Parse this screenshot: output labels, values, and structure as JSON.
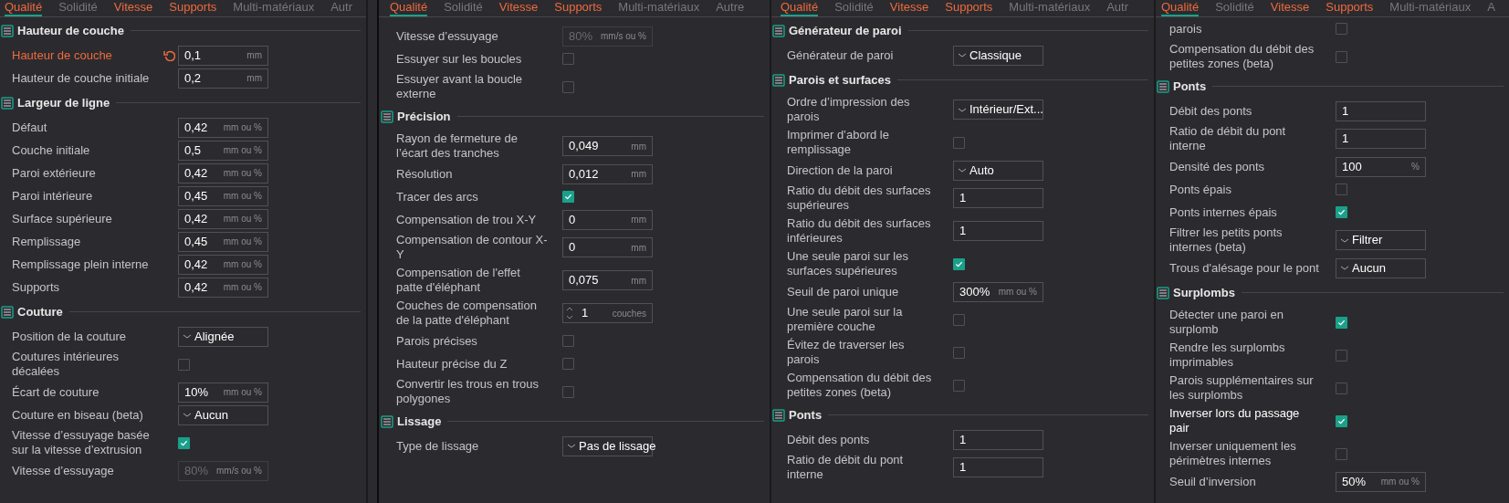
{
  "panels": [
    {
      "tabs": [
        {
          "label": "Qualité",
          "selected": true,
          "modified": true
        },
        {
          "label": "Solidité",
          "selected": false,
          "modified": false
        },
        {
          "label": "Vitesse",
          "selected": false,
          "modified": true
        },
        {
          "label": "Supports",
          "selected": false,
          "modified": true
        },
        {
          "label": "Multi-matériaux",
          "selected": false,
          "modified": false
        },
        {
          "label": "Autr",
          "selected": false,
          "modified": false
        }
      ],
      "items": [
        {
          "kind": "section",
          "title": "Hauteur de couche"
        },
        {
          "kind": "field",
          "label": "Hauteur de couche",
          "value": "0,1",
          "unit": "mm",
          "disabled": false,
          "modified": true,
          "hovered": false
        },
        {
          "kind": "field",
          "label": "Hauteur de couche initiale",
          "value": "0,2",
          "unit": "mm",
          "disabled": false,
          "modified": false,
          "hovered": false
        },
        {
          "kind": "section",
          "title": "Largeur de ligne"
        },
        {
          "kind": "field",
          "label": "Défaut",
          "value": "0,42",
          "unit": "mm ou %",
          "disabled": false,
          "modified": false,
          "hovered": false
        },
        {
          "kind": "field",
          "label": "Couche initiale",
          "value": "0,5",
          "unit": "mm ou %",
          "disabled": false,
          "modified": false,
          "hovered": false
        },
        {
          "kind": "field",
          "label": "Paroi extérieure",
          "value": "0,42",
          "unit": "mm ou %",
          "disabled": false,
          "modified": false,
          "hovered": false
        },
        {
          "kind": "field",
          "label": "Paroi intérieure",
          "value": "0,45",
          "unit": "mm ou %",
          "disabled": false,
          "modified": false,
          "hovered": false
        },
        {
          "kind": "field",
          "label": "Surface supérieure",
          "value": "0,42",
          "unit": "mm ou %",
          "disabled": false,
          "modified": false,
          "hovered": false
        },
        {
          "kind": "field",
          "label": "Remplissage",
          "value": "0,45",
          "unit": "mm ou %",
          "disabled": false,
          "modified": false,
          "hovered": false
        },
        {
          "kind": "field",
          "label": "Remplissage plein interne",
          "value": "0,42",
          "unit": "mm ou %",
          "disabled": false,
          "modified": false,
          "hovered": false
        },
        {
          "kind": "field",
          "label": "Supports",
          "value": "0,42",
          "unit": "mm ou %",
          "disabled": false,
          "modified": false,
          "hovered": false
        },
        {
          "kind": "section",
          "title": "Couture"
        },
        {
          "kind": "combo",
          "label": "Position de la couture",
          "value": "Alignée",
          "modified": false,
          "hovered": false
        },
        {
          "kind": "checkbox",
          "label": "Coutures intérieures décalées",
          "checked": false,
          "modified": false,
          "hovered": false
        },
        {
          "kind": "field",
          "label": "Écart de couture",
          "value": "10%",
          "unit": "mm ou %",
          "disabled": false,
          "modified": false,
          "hovered": false
        },
        {
          "kind": "combo",
          "label": "Couture en biseau (beta)",
          "value": "Aucun",
          "modified": false,
          "hovered": false
        },
        {
          "kind": "checkbox",
          "label": "Vitesse d’essuyage basée sur la vitesse d’extrusion",
          "checked": true,
          "modified": false,
          "hovered": false
        },
        {
          "kind": "field",
          "label": "Vitesse d’essuyage",
          "value": "80%",
          "unit": "mm/s ou %",
          "disabled": true,
          "modified": false,
          "hovered": false
        }
      ]
    },
    {
      "tabs": [
        {
          "label": "Qualité",
          "selected": true,
          "modified": true
        },
        {
          "label": "Solidité",
          "selected": false,
          "modified": false
        },
        {
          "label": "Vitesse",
          "selected": false,
          "modified": true
        },
        {
          "label": "Supports",
          "selected": false,
          "modified": true
        },
        {
          "label": "Multi-matériaux",
          "selected": false,
          "modified": false
        },
        {
          "label": "Autre",
          "selected": false,
          "modified": false
        }
      ],
      "items": [
        {
          "kind": "field",
          "label": "Vitesse d’essuyage",
          "value": "80%",
          "unit": "mm/s ou %",
          "disabled": true,
          "modified": false,
          "hovered": false
        },
        {
          "kind": "checkbox",
          "label": "Essuyer sur les boucles",
          "checked": false,
          "modified": false,
          "hovered": false
        },
        {
          "kind": "checkbox",
          "label": "Essuyer avant la boucle externe",
          "checked": false,
          "modified": false,
          "hovered": false
        },
        {
          "kind": "section",
          "title": "Précision"
        },
        {
          "kind": "field",
          "label": "Rayon de fermeture de l’écart des tranches",
          "value": "0,049",
          "unit": "mm",
          "disabled": false,
          "modified": false,
          "hovered": false
        },
        {
          "kind": "field",
          "label": "Résolution",
          "value": "0,012",
          "unit": "mm",
          "disabled": false,
          "modified": false,
          "hovered": false
        },
        {
          "kind": "checkbox",
          "label": "Tracer des arcs",
          "checked": true,
          "modified": false,
          "hovered": false
        },
        {
          "kind": "field",
          "label": "Compensation de trou X-Y",
          "value": "0",
          "unit": "mm",
          "disabled": false,
          "modified": false,
          "hovered": false
        },
        {
          "kind": "field",
          "label": "Compensation de contour X-Y",
          "value": "0",
          "unit": "mm",
          "disabled": false,
          "modified": false,
          "hovered": false
        },
        {
          "kind": "field",
          "label": "Compensation de l'effet patte d'éléphant",
          "value": "0,075",
          "unit": "mm",
          "disabled": false,
          "modified": false,
          "hovered": false
        },
        {
          "kind": "spin",
          "label": "Couches de compensation de la patte d'éléphant",
          "value": "1",
          "unit": "couches",
          "modified": false,
          "hovered": false
        },
        {
          "kind": "checkbox",
          "label": "Parois précises",
          "checked": false,
          "modified": false,
          "hovered": false
        },
        {
          "kind": "checkbox",
          "label": "Hauteur précise du Z",
          "checked": false,
          "modified": false,
          "hovered": false
        },
        {
          "kind": "checkbox",
          "label": "Convertir les trous en trous polygones",
          "checked": false,
          "modified": false,
          "hovered": false
        },
        {
          "kind": "section",
          "title": "Lissage"
        },
        {
          "kind": "combo",
          "label": "Type de lissage",
          "value": "Pas de lissage",
          "modified": false,
          "hovered": false
        }
      ]
    },
    {
      "tabs": [
        {
          "label": "Qualité",
          "selected": true,
          "modified": true
        },
        {
          "label": "Solidité",
          "selected": false,
          "modified": false
        },
        {
          "label": "Vitesse",
          "selected": false,
          "modified": true
        },
        {
          "label": "Supports",
          "selected": false,
          "modified": true
        },
        {
          "label": "Multi-matériaux",
          "selected": false,
          "modified": false
        },
        {
          "label": "Autr",
          "selected": false,
          "modified": false
        }
      ],
      "items": [
        {
          "kind": "section",
          "title": "Générateur de paroi"
        },
        {
          "kind": "combo",
          "label": "Générateur de paroi",
          "value": "Classique",
          "modified": false,
          "hovered": false
        },
        {
          "kind": "section",
          "title": "Parois et surfaces"
        },
        {
          "kind": "combo",
          "label": "Ordre d’impression des parois",
          "value": "Intérieur/Ext...",
          "modified": false,
          "hovered": false
        },
        {
          "kind": "checkbox",
          "label": "Imprimer d’abord le remplissage",
          "checked": false,
          "modified": false,
          "hovered": false
        },
        {
          "kind": "combo",
          "label": "Direction de la paroi",
          "value": "Auto",
          "modified": false,
          "hovered": false
        },
        {
          "kind": "field",
          "label": "Ratio du débit des surfaces supérieures",
          "value": "1",
          "disabled": false,
          "modified": false,
          "hovered": false
        },
        {
          "kind": "field",
          "label": "Ratio du débit des surfaces inférieures",
          "value": "1",
          "disabled": false,
          "modified": false,
          "hovered": false
        },
        {
          "kind": "checkbox",
          "label": "Une seule paroi sur les surfaces supérieures",
          "checked": true,
          "modified": false,
          "hovered": false
        },
        {
          "kind": "field",
          "label": "Seuil de paroi unique",
          "value": "300%",
          "unit": "mm ou %",
          "disabled": false,
          "modified": false,
          "hovered": false
        },
        {
          "kind": "checkbox",
          "label": "Une seule paroi sur la première couche",
          "checked": false,
          "modified": false,
          "hovered": false
        },
        {
          "kind": "checkbox",
          "label": "Évitez de traverser les parois",
          "checked": false,
          "modified": false,
          "hovered": false
        },
        {
          "kind": "checkbox",
          "label": "Compensation du débit des petites zones (beta)",
          "checked": false,
          "modified": false,
          "hovered": false
        },
        {
          "kind": "section",
          "title": "Ponts"
        },
        {
          "kind": "field",
          "label": "Débit des ponts",
          "value": "1",
          "disabled": false,
          "modified": false,
          "hovered": false
        },
        {
          "kind": "field",
          "label": "Ratio de débit du pont interne",
          "value": "1",
          "disabled": false,
          "modified": false,
          "hovered": false
        }
      ]
    },
    {
      "tabs": [
        {
          "label": "Qualité",
          "selected": true,
          "modified": true
        },
        {
          "label": "Solidité",
          "selected": false,
          "modified": false
        },
        {
          "label": "Vitesse",
          "selected": false,
          "modified": true
        },
        {
          "label": "Supports",
          "selected": false,
          "modified": true
        },
        {
          "label": "Multi-matériaux",
          "selected": false,
          "modified": false
        },
        {
          "label": "A",
          "selected": false,
          "modified": false
        }
      ],
      "items": [
        {
          "kind": "checkbox",
          "label": "parois",
          "checked": false,
          "modified": false,
          "hovered": false
        },
        {
          "kind": "checkbox",
          "label": "Compensation du débit des petites zones (beta)",
          "checked": false,
          "modified": false,
          "hovered": false
        },
        {
          "kind": "section",
          "title": "Ponts"
        },
        {
          "kind": "field",
          "label": "Débit des ponts",
          "value": "1",
          "disabled": false,
          "modified": false,
          "hovered": false
        },
        {
          "kind": "field",
          "label": "Ratio de débit du pont interne",
          "value": "1",
          "disabled": false,
          "modified": false,
          "hovered": false
        },
        {
          "kind": "field",
          "label": "Densité des ponts",
          "value": "100",
          "unit": "%",
          "disabled": false,
          "modified": false,
          "hovered": false
        },
        {
          "kind": "checkbox",
          "label": "Ponts épais",
          "checked": false,
          "modified": false,
          "hovered": false
        },
        {
          "kind": "checkbox",
          "label": "Ponts internes épais",
          "checked": true,
          "modified": false,
          "hovered": false
        },
        {
          "kind": "combo",
          "label": "Filtrer les petits ponts internes (beta)",
          "value": "Filtrer",
          "modified": false,
          "hovered": false
        },
        {
          "kind": "combo",
          "label": "Trous d'alésage pour le pont",
          "value": "Aucun",
          "modified": false,
          "hovered": false
        },
        {
          "kind": "section",
          "title": "Surplombs"
        },
        {
          "kind": "checkbox",
          "label": "Détecter une paroi en surplomb",
          "checked": true,
          "modified": false,
          "hovered": false
        },
        {
          "kind": "checkbox",
          "label": "Rendre les surplombs imprimables",
          "checked": false,
          "modified": false,
          "hovered": false
        },
        {
          "kind": "checkbox",
          "label": "Parois supplémentaires sur les surplombs",
          "checked": false,
          "modified": false,
          "hovered": false
        },
        {
          "kind": "checkbox",
          "label": "Inverser lors du passage pair",
          "checked": true,
          "modified": false,
          "hovered": true
        },
        {
          "kind": "checkbox",
          "label": "Inverser uniquement les périmètres internes",
          "checked": false,
          "modified": false,
          "hovered": false
        },
        {
          "kind": "field",
          "label": "Seuil d’inversion",
          "value": "50%",
          "unit": "mm ou %",
          "disabled": false,
          "modified": false,
          "hovered": false
        }
      ]
    }
  ]
}
